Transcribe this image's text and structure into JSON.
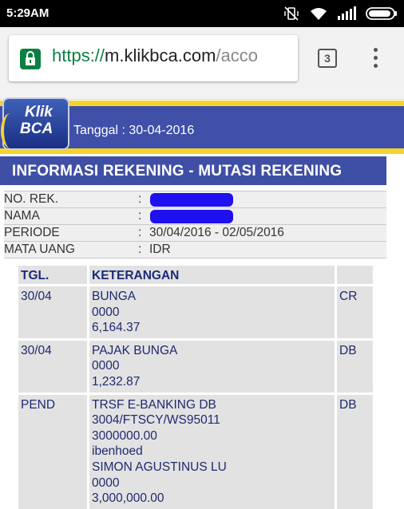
{
  "status": {
    "time": "5:29AM"
  },
  "browser": {
    "url_scheme": "https://",
    "url_host": "m.klikbca.com",
    "url_path": "/acco",
    "tab_count": "3"
  },
  "header": {
    "logo_klik": "Klik",
    "logo_bca": "BCA",
    "date_text": "Tanggal : 30-04-2016"
  },
  "title": "INFORMASI REKENING - MUTASI REKENING",
  "info": [
    {
      "label": "NO. REK.",
      "value": ""
    },
    {
      "label": "NAMA",
      "value": ""
    },
    {
      "label": "PERIODE",
      "value": "30/04/2016 - 02/05/2016"
    },
    {
      "label": "MATA UANG",
      "value": "IDR"
    }
  ],
  "table": {
    "headers": [
      "TGL.",
      "KETERANGAN",
      ""
    ],
    "rows": [
      {
        "date": "30/04",
        "desc": [
          "BUNGA",
          "0000",
          "6,164.37"
        ],
        "type": "CR"
      },
      {
        "date": "30/04",
        "desc": [
          "PAJAK BUNGA",
          "0000",
          "1,232.87"
        ],
        "type": "DB"
      },
      {
        "date": "PEND",
        "desc": [
          "TRSF E-BANKING DB",
          "3004/FTSCY/WS95011",
          "3000000.00",
          "ibenhoed",
          "SIMON AGUSTINUS LU",
          "0000",
          "3,000,000.00"
        ],
        "type": "DB"
      }
    ]
  },
  "colors": {
    "banner": "#4050a8",
    "accent_yellow": "#f5d430",
    "title_bar": "#3f4fa6",
    "url_scheme": "#0b8043",
    "redaction": "#1f10f0"
  }
}
